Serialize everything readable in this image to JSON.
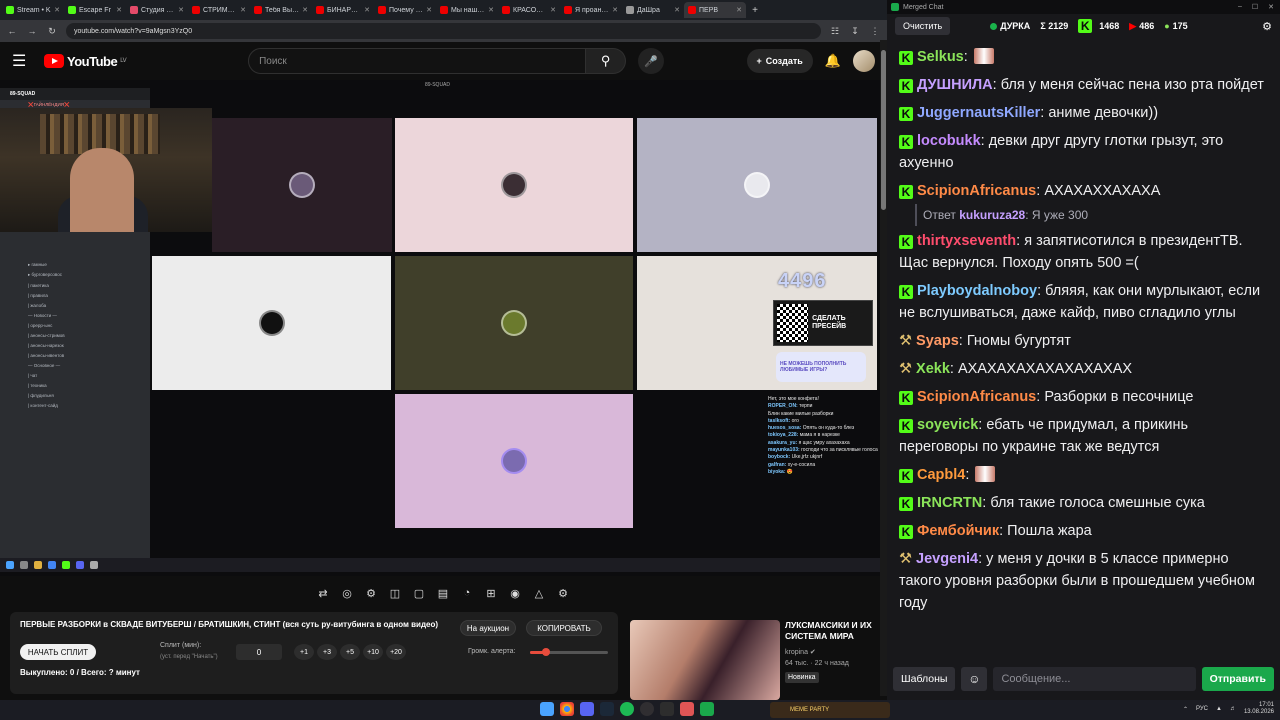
{
  "browser": {
    "tabs": [
      {
        "label": "Stream • K",
        "color": "#53fc18"
      },
      {
        "label": "Escape Fr",
        "color": "#53fc18"
      },
      {
        "label": "Студия …",
        "color": "#e54b6a"
      },
      {
        "label": "СТРИМЕР…",
        "color": "#e00"
      },
      {
        "label": "Тебя Выу…",
        "color": "#e00"
      },
      {
        "label": "БИНАРН…",
        "color": "#e00"
      },
      {
        "label": "Почему Я…",
        "color": "#e00"
      },
      {
        "label": "Мы нашл…",
        "color": "#e00"
      },
      {
        "label": "КРАСОТА…",
        "color": "#e00"
      },
      {
        "label": "Я проан…",
        "color": "#e00"
      },
      {
        "label": "ДаШра",
        "color": "#999"
      },
      {
        "label": "ПЕРВ",
        "color": "#e00"
      }
    ],
    "url": "youtube.com/watch?v=9aMgsn3YzQ0"
  },
  "youtube": {
    "logo": "YouTube",
    "region": "LV",
    "search_placeholder": "Поиск",
    "create_label": "Создать"
  },
  "video": {
    "top_label": "89-SQUAD",
    "discord_server": "89-SQUAD",
    "discord_lines": [
      "❌ГАЙНЛЁНДИЯ❌",
      "",
      "",
      "",
      "",
      "",
      "",
      "",
      "",
      "",
      "",
      "",
      "",
      "",
      "",
      "",
      "▸ гамные",
      "▸ бурговерсовос",
      "| пакетика",
      "| правила",
      "| жалоба",
      "— Новости —",
      "| орерр-ынс",
      "| анонсы-стримов",
      "| анонсы-нарезок",
      "| анонсы-ивентов",
      "— Основное —",
      "| чат",
      "| техника",
      "| флудильня",
      "| контент-сайд"
    ],
    "counter": "4496",
    "qr_text": "СДЕЛАТЬ ПРЕСЕЙВ",
    "donate_text": "НЕ МОЖЕШЬ ПОПОЛНИТЬ ЛЮБИМЫЕ ИГРЫ?",
    "chat_lines": [
      {
        "nick": "",
        "text": "Нет, это мое конфета!"
      },
      {
        "nick": "ROPER_ON:",
        "text": "терпи"
      },
      {
        "nick": "",
        "text": "Блин какие милые разборки"
      },
      {
        "nick": "taslksoft:",
        "text": "ого"
      },
      {
        "nick": "huesos_sosa:",
        "text": "Опять он куда-то блез"
      },
      {
        "nick": "tokioya_228:",
        "text": "мама я в нарезке"
      },
      {
        "nick": "asakura_yu:",
        "text": "я щас умру ахахахаха"
      },
      {
        "nick": "mayunka103:",
        "text": "господи что за писклявые голоса"
      },
      {
        "nick": "boybock:",
        "text": "Uke,jrfz ukjnrf"
      },
      {
        "nick": "galfran:",
        "text": "ху-е-сосила"
      },
      {
        "nick": "biyoka:",
        "text": "😍"
      }
    ]
  },
  "panel": {
    "title": "ПЕРВЫЕ РАЗБОРКИ в СКВАДЕ ВИТУБЕРШ / БРАТИШКИН, СТИНТ (вся суть ру-витубинга в одном видео)",
    "auction_label": "На аукцион",
    "copy_label": "КОПИРОВАТЬ",
    "start_split_label": "НАЧАТЬ СПЛИТ",
    "split_label": "Сплит (мин):",
    "split_hint": "(уст. перед \"Начать\")",
    "split_value": "0",
    "increments": [
      "+1",
      "+3",
      "+5",
      "+10",
      "+20"
    ],
    "volume_label": "Громк. алерта:",
    "volume_level": 0.2,
    "summary": "Выкуплено: 0 / Всего: ? минут"
  },
  "side_video": {
    "title": "ЛУКСМАКСИКИ И ИХ СИСТЕМА МИРА",
    "channel": "kropina ✔",
    "meta": "64 тыс. · 22 ч назад",
    "badge": "Новинка"
  },
  "chat": {
    "window_title": "Merged Chat",
    "clear_label": "Очистить",
    "channel": "ДУРКА",
    "total": "Σ 2129",
    "kick_count": "1468",
    "yt_count": "486",
    "other_count": "175",
    "messages": [
      {
        "nick": "Selkus",
        "color": "#8be45a",
        "text": "",
        "badge": "k"
      },
      {
        "nick": "ДУШНИЛА",
        "color": "#c5a0ff",
        "text": "бля у меня сейчас пена изо рта пойдет",
        "badge": "k"
      },
      {
        "nick": "JuggernautsKiller",
        "color": "#8fa8ff",
        "text": "аниме девочки))",
        "badge": "k"
      },
      {
        "nick": "locobukk",
        "color": "#c58bff",
        "text": "девки друг другу глотки грызут, это ахуенно",
        "badge": "k"
      },
      {
        "nick": "ScipionAfricanus",
        "color": "#ff8a47",
        "text": "АХАХАХХАХАХА",
        "badge": "k"
      },
      {
        "nick": "thirtyxseventh",
        "color": "#ff4d6d",
        "text": "я запятисотился в президентТВ. Щас вернулся. Походу опять 500 =(",
        "badge": "k"
      },
      {
        "nick": "Playboydalnoboy",
        "color": "#7ecbff",
        "text": "бляяя, как они мурлыкают, если не вслушиваться, даже кайф, пиво сгладило углы",
        "badge": "k"
      },
      {
        "nick": "Syaps",
        "color": "#ff9a66",
        "text": "Гномы бугуртят",
        "badge": "e"
      },
      {
        "nick": "Xekk",
        "color": "#8be45a",
        "text": "АХАХАХАХАХАХАХАХАХ",
        "badge": "e"
      },
      {
        "nick": "ScipionAfricanus",
        "color": "#ff8a47",
        "text": "Разборки в песочнице",
        "badge": "k"
      },
      {
        "nick": "soyevick",
        "color": "#8be45a",
        "text": "ебать че придумал, а прикинь переговоры по украине так же ведутся",
        "badge": "k"
      },
      {
        "nick": "Capbl4",
        "color": "#ff9a3c",
        "text": "",
        "badge": "k"
      },
      {
        "nick": "IRNCRTN",
        "color": "#8be45a",
        "text": "бля такие голоса смешные сука",
        "badge": "k"
      },
      {
        "nick": "Фембойчик",
        "color": "#ff8a47",
        "text": "Пошла жара",
        "badge": "k"
      },
      {
        "nick": "Jevgeni4",
        "color": "#c5a0ff",
        "text": "у меня у дочки в 5 классе примерно такого уровня разборки были в прошедшем учебном году",
        "badge": "e"
      }
    ],
    "reply": {
      "prefix": "Ответ",
      "nick": "kukuruza28",
      "text": "Я уже 300"
    },
    "templates_label": "Шаблоны",
    "input_placeholder": "Сообщение...",
    "send_label": "Отправить"
  },
  "taskbar": {
    "meme_label": "MEME PARTY",
    "lang": "РУС",
    "time": "17:01",
    "date": "13.08.2026"
  }
}
